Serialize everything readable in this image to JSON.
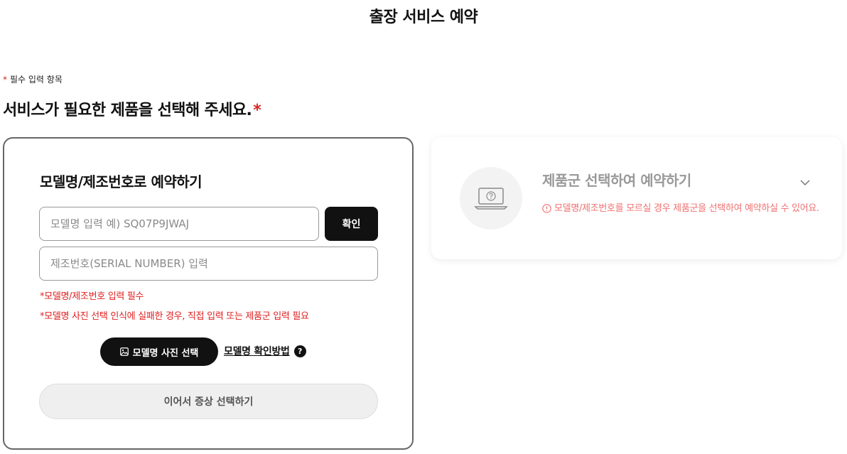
{
  "page": {
    "title": "출장 서비스 예약"
  },
  "form": {
    "required_star": "*",
    "required_note": "필수 입력 항목",
    "section_heading": "서비스가 필요한 제품을 선택해 주세요.",
    "section_heading_star": "*"
  },
  "model_card": {
    "title": "모델명/제조번호로 예약하기",
    "model_input_placeholder": "모델명 입력 예) SQ07P9JWAJ",
    "confirm_label": "확인",
    "serial_input_placeholder": "제조번호(SERIAL NUMBER) 입력",
    "warning_1": "*모델명/제조번호 입력 필수",
    "warning_2": "*모델명 사진 선택 인식에 실패한 경우, 직접 입력 또는 제품군 입력 필요",
    "photo_button_label": "모델명 사진 선택",
    "howto_label": "모델명 확인방법",
    "help_glyph": "?",
    "next_button_label": "이어서 증상 선택하기"
  },
  "group_card": {
    "title": "제품군 선택하여 예약하기",
    "info_text": "모델명/제조번호를 모르실 경우 제품군을 선택하여 예약하실 수 있어요."
  },
  "icons": {
    "laptop": "laptop-question-icon",
    "chevron": "chevron-down-icon",
    "info": "info-circle-icon",
    "image": "image-icon",
    "help": "question-circle-icon"
  },
  "colors": {
    "accent_red": "#d62424",
    "warning_red": "#e02020",
    "info_pink": "#f07070",
    "button_dark": "#111111",
    "disabled_gray": "#efefef"
  }
}
